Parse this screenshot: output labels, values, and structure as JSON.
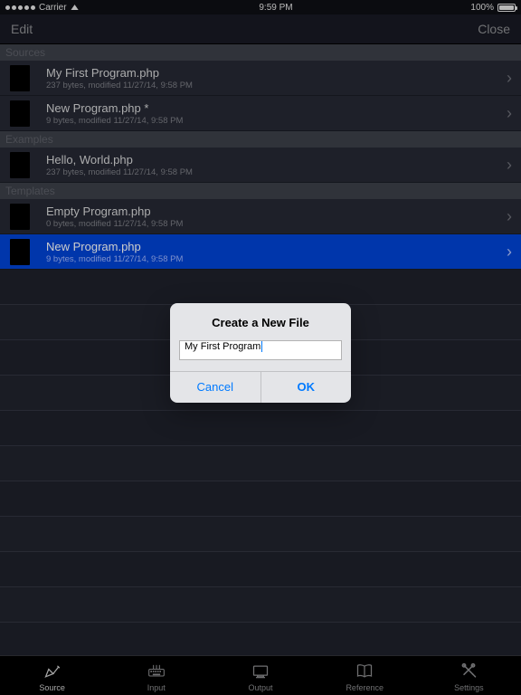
{
  "status": {
    "carrier": "Carrier",
    "time": "9:59 PM",
    "battery_pct": "100%"
  },
  "nav": {
    "left": "Edit",
    "right": "Close"
  },
  "sections": [
    {
      "header": "Sources",
      "rows": [
        {
          "title": "My First Program.php",
          "sub": "237 bytes, modified 11/27/14, 9:58 PM",
          "selected": false
        },
        {
          "title": "New Program.php *",
          "sub": "9 bytes, modified 11/27/14, 9:58 PM",
          "selected": false
        }
      ]
    },
    {
      "header": "Examples",
      "rows": [
        {
          "title": "Hello, World.php",
          "sub": "237 bytes, modified 11/27/14, 9:58 PM",
          "selected": false
        }
      ]
    },
    {
      "header": "Templates",
      "rows": [
        {
          "title": "Empty Program.php",
          "sub": "0 bytes, modified 11/27/14, 9:58 PM",
          "selected": false
        },
        {
          "title": "New Program.php",
          "sub": "9 bytes, modified 11/27/14, 9:58 PM",
          "selected": true
        }
      ]
    }
  ],
  "dialog": {
    "title": "Create a New File",
    "value": "My First Program",
    "cancel": "Cancel",
    "ok": "OK"
  },
  "tabs": [
    {
      "id": "source",
      "label": "Source",
      "active": true
    },
    {
      "id": "input",
      "label": "Input",
      "active": false
    },
    {
      "id": "output",
      "label": "Output",
      "active": false
    },
    {
      "id": "reference",
      "label": "Reference",
      "active": false
    },
    {
      "id": "settings",
      "label": "Settings",
      "active": false
    }
  ]
}
